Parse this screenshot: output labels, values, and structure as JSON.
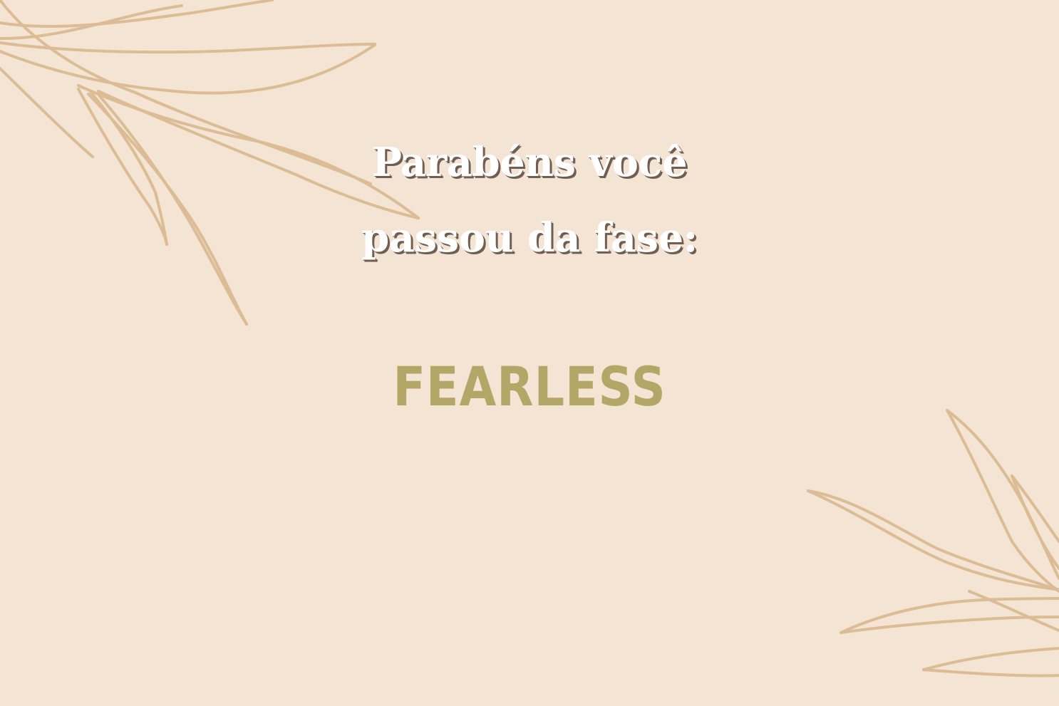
{
  "message": {
    "line1": "Parabéns você",
    "line2": "passou da fase:",
    "stage": "FEARLESS"
  },
  "decorations": {
    "top_left": "leaf-branch-icon",
    "bottom_right": "leaf-branch-icon"
  },
  "colors": {
    "background": "#f3e4d4",
    "leaf_stroke": "#dcbc95",
    "headline": "#ffffff",
    "headline_shadow": "#6f5e51",
    "stage": "#b4a667"
  }
}
